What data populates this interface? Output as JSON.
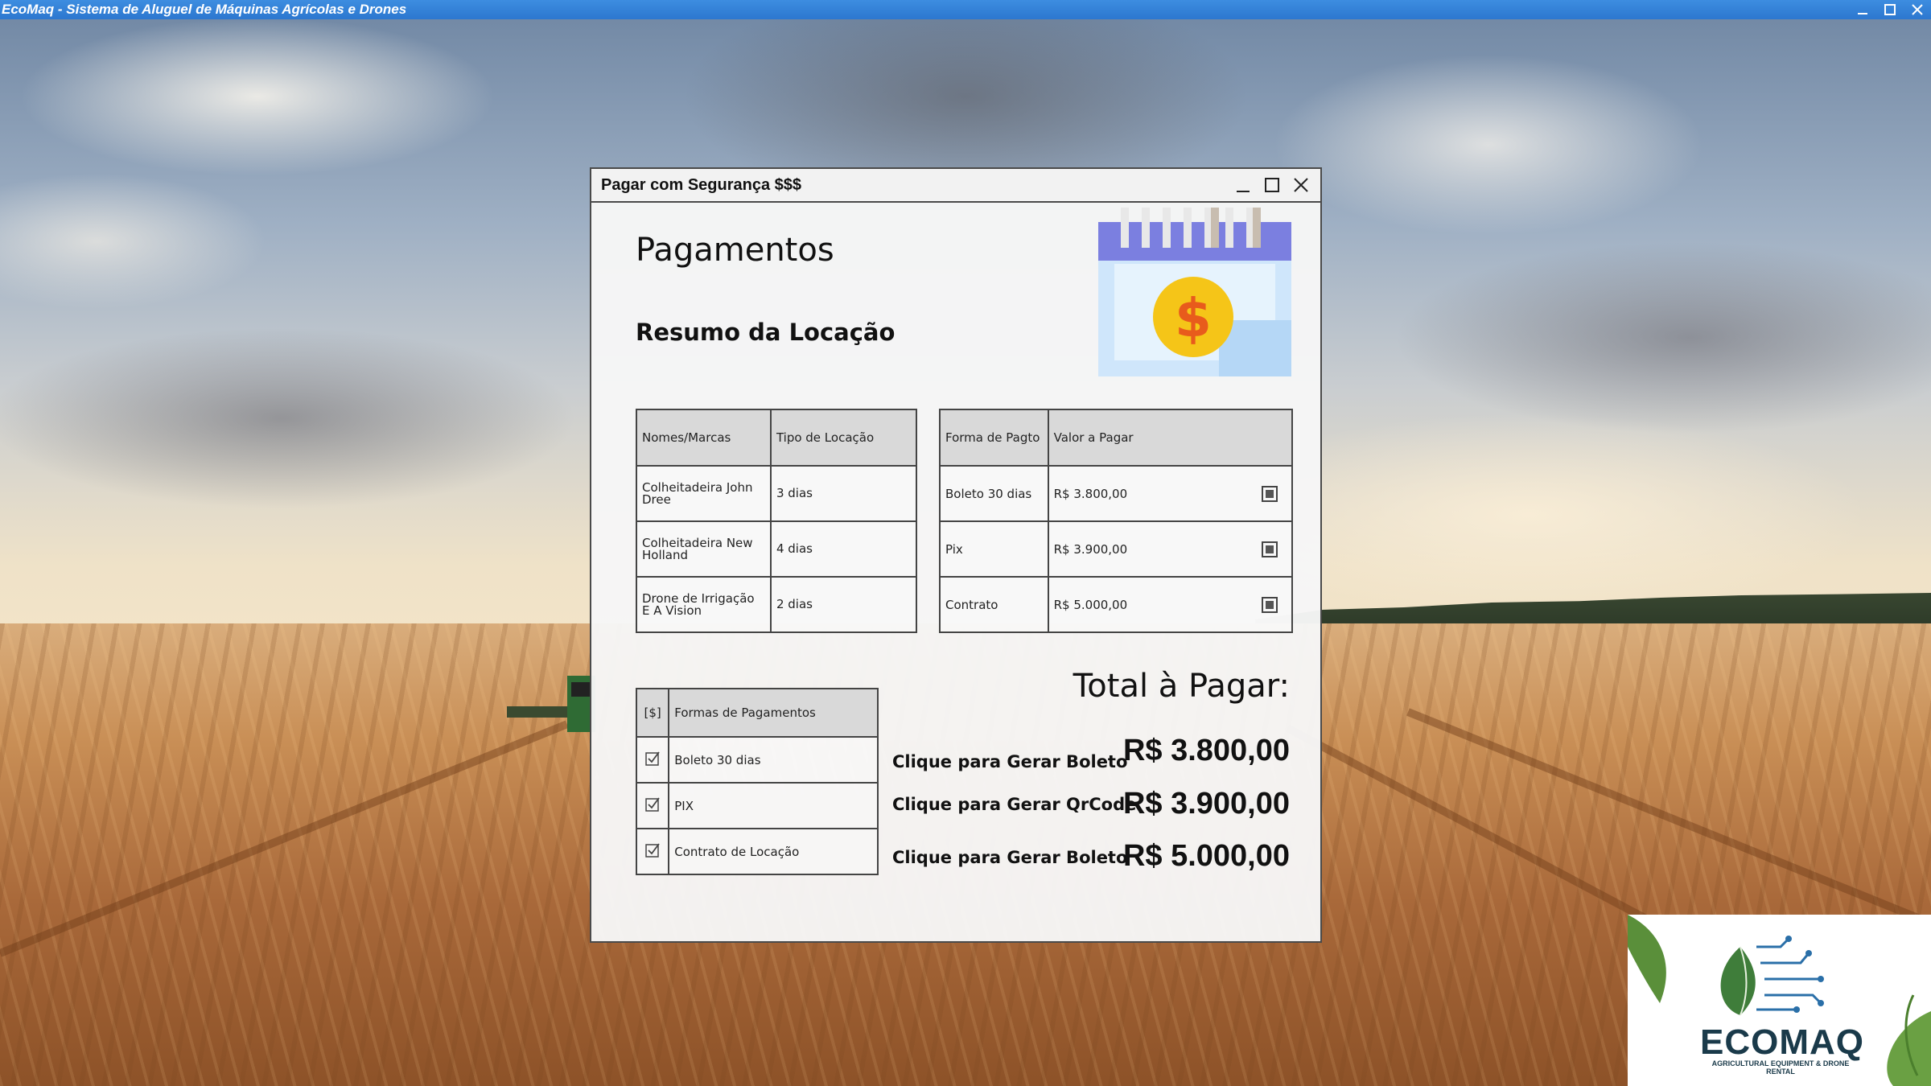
{
  "app": {
    "title": "EcoMaq - Sistema de Aluguel de Máquinas Agrícolas e Drones"
  },
  "dialog": {
    "title": "Pagar com Segurança $$$",
    "heading": "Pagamentos",
    "subheading": "Resumo da Locação"
  },
  "rental_table": {
    "headers": [
      "Nomes/Marcas",
      "Tipo de Locação"
    ],
    "rows": [
      {
        "name": "Colheitadeira John Dree",
        "type": "3 dias"
      },
      {
        "name": "Colheitadeira New Holland",
        "type": "4 dias"
      },
      {
        "name": "Drone de Irrigação E A Vision",
        "type": "2 dias"
      }
    ]
  },
  "payment_table": {
    "headers": [
      "Forma de Pagto",
      "Valor a Pagar"
    ],
    "rows": [
      {
        "method": "Boleto 30 dias",
        "value": "R$ 3.800,00"
      },
      {
        "method": "Pix",
        "value": "R$ 3.900,00"
      },
      {
        "method": "Contrato",
        "value": "R$ 5.000,00"
      }
    ]
  },
  "forms_table": {
    "headers": [
      "[$]",
      "Formas de Pagamentos"
    ],
    "rows": [
      {
        "label": "Boleto 30 dias",
        "checked": true
      },
      {
        "label": "PIX",
        "checked": true
      },
      {
        "label": "Contrato de Locação",
        "checked": true
      }
    ]
  },
  "totals": {
    "label": "Total à Pagar:",
    "actions": [
      "Clique para Gerar Boleto",
      "Clique para Gerar QrCode",
      "Clique para Gerar Boleto"
    ],
    "amounts": [
      "R$ 3.800,00",
      "R$ 3.900,00",
      "R$ 5.000,00"
    ]
  },
  "logo": {
    "name": "ECOMAQ",
    "tagline": "AGRICULTURAL EQUIPMENT & DRONE RENTAL"
  },
  "colors": {
    "titlebar": "#2c77cf",
    "calendar_top": "#7b7fe0",
    "calendar_body": "#cfe6fb",
    "coin": "#f5c518",
    "dollar": "#e85b1c"
  }
}
